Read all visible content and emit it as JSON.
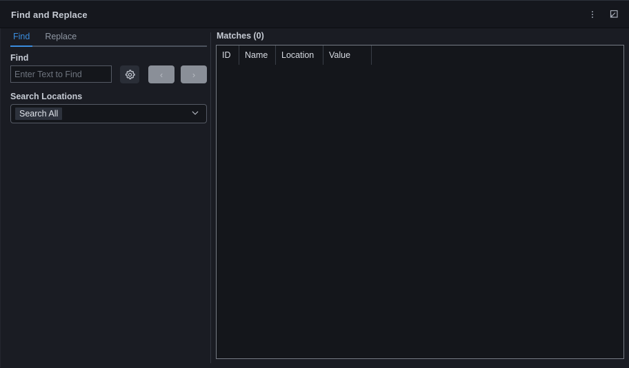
{
  "window": {
    "title": "Find and Replace",
    "actions": [
      {
        "name": "more-options",
        "label": "⋮"
      },
      {
        "name": "undock-panel",
        "label": ""
      }
    ]
  },
  "tabs": [
    {
      "label": "Find",
      "active": true
    },
    {
      "label": "Replace",
      "active": false
    }
  ],
  "find_panel": {
    "find_label": "Find",
    "find_placeholder": "Enter Text to Find",
    "find_value": "",
    "options_icon": "gear-icon",
    "prev_label": "‹",
    "next_label": "›",
    "search_locations_label": "Search Locations",
    "search_locations_value": "Search All"
  },
  "matches": {
    "title": "Matches (0)",
    "columns": [
      "ID",
      "Name",
      "Location",
      "Value"
    ],
    "rows": []
  },
  "colors": {
    "accent": "#3b8ee0",
    "panel_bg": "#1a1c23",
    "titlebar_bg": "#15171d",
    "field_bg": "#14161b",
    "text": "#c6cbd4",
    "muted_text": "#9098a4",
    "border": "#565b66",
    "button_disabled": "#8a8f98"
  }
}
